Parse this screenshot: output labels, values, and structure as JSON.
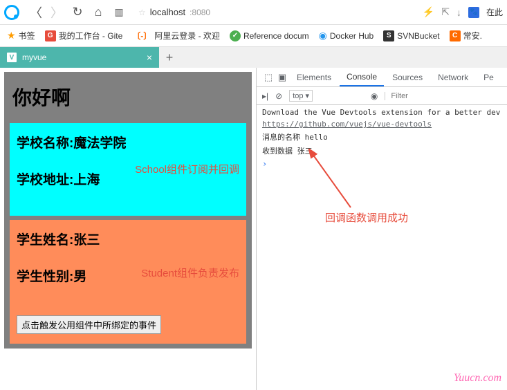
{
  "browser": {
    "url_host": "localhost",
    "url_port": ":8080",
    "right_text": "在此"
  },
  "bookmarks": {
    "label": "书签",
    "items": [
      "我的工作台 - Gite",
      "阿里云登录 - 欢迎",
      "Reference docum",
      "Docker Hub",
      "SVNBucket",
      "常安."
    ]
  },
  "tab": {
    "title": "myvue"
  },
  "page": {
    "greeting": "你好啊",
    "school": {
      "name_label": "学校名称:魔法学院",
      "addr_label": "学校地址:上海",
      "note": "School组件订阅并回调"
    },
    "student": {
      "name_label": "学生姓名:张三",
      "gender_label": "学生性别:男",
      "note": "Student组件负责发布",
      "button": "点击触发公用组件中所绑定的事件"
    }
  },
  "devtools": {
    "tabs": [
      "Elements",
      "Console",
      "Sources",
      "Network",
      "Pe"
    ],
    "active_tab": "Console",
    "context": "top",
    "filter_placeholder": "Filter",
    "log": {
      "line1": "Download the Vue Devtools extension for a better dev",
      "link": "https://github.com/vuejs/vue-devtools",
      "line2": "消息的名称 hello",
      "line3": "收到数据 张三"
    }
  },
  "annotation": {
    "text": "回调函数调用成功"
  },
  "watermark": "Yuucn.com"
}
